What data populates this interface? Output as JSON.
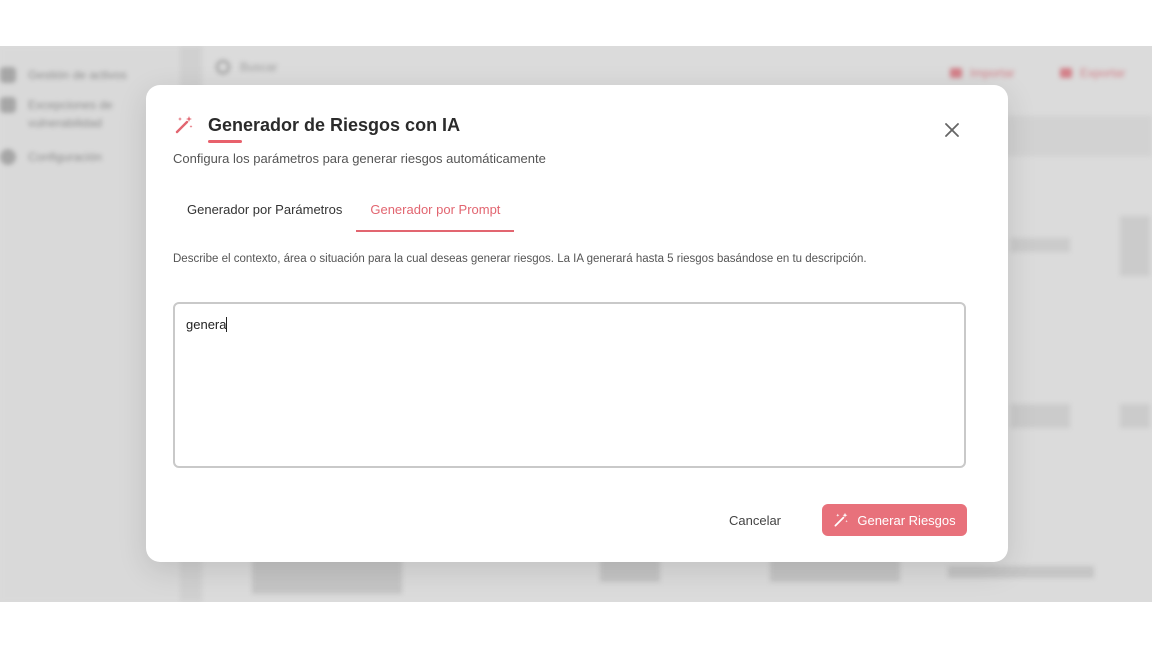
{
  "background": {
    "sidebar_items": [
      "Gestión de activos",
      "Excepciones de vulnerabilidad",
      "Configuración"
    ],
    "search_placeholder": "Buscar",
    "top_buttons": [
      "Importar",
      "Exportar"
    ]
  },
  "modal": {
    "title": "Generador de Riesgos con IA",
    "subtitle": "Configura los parámetros para generar riesgos automáticamente",
    "tabs": [
      {
        "label": "Generador por Parámetros",
        "active": false
      },
      {
        "label": "Generador por Prompt",
        "active": true
      }
    ],
    "description": "Describe el contexto, área o situación para la cual deseas generar riesgos. La IA generará hasta 5 riesgos basándose en tu descripción.",
    "prompt_value": "genera",
    "cancel_label": "Cancelar",
    "generate_label": "Generar Riesgos",
    "icons": [
      "magic-wand-icon",
      "close-icon"
    ]
  },
  "colors": {
    "accent": "#e26570",
    "button": "#e8717b"
  }
}
